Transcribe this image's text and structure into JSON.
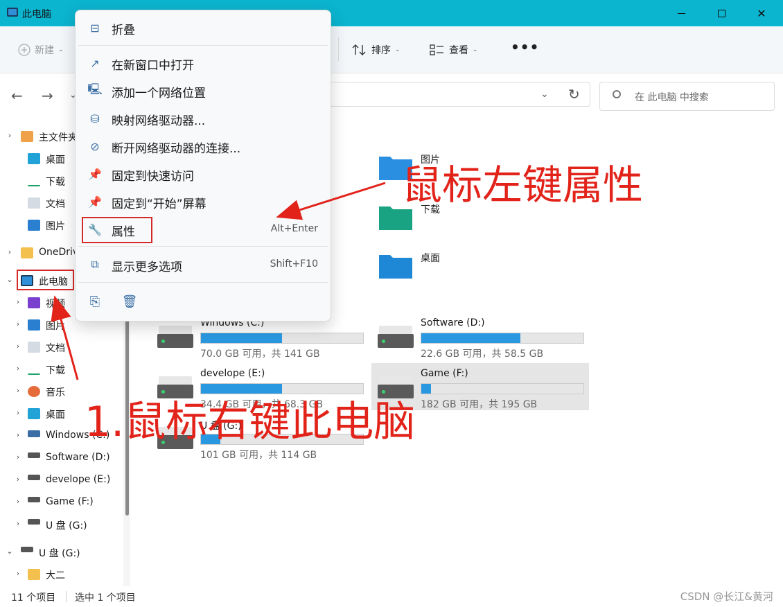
{
  "window": {
    "title": "此电脑",
    "controls": {
      "minimize": "minimize",
      "maximize": "maximize",
      "close": "✕"
    }
  },
  "toolbar": {
    "new_label": "新建",
    "sort_label": "排序",
    "view_label": "查看",
    "more_label": "•••"
  },
  "search": {
    "placeholder": "在 此电脑 中搜索"
  },
  "sidebar": {
    "items": [
      {
        "label": "主文件夹",
        "expander": "›",
        "icon": "home-icon"
      },
      {
        "label": "桌面",
        "icon": "desktop-icon"
      },
      {
        "label": "下载",
        "icon": "download-icon"
      },
      {
        "label": "文档",
        "icon": "document-icon"
      },
      {
        "label": "图片",
        "icon": "pictures-icon"
      },
      {
        "label": "OneDrive",
        "expander": "›",
        "icon": "folder-icon"
      },
      {
        "label": "此电脑",
        "expander": "⌄",
        "icon": "pc-icon"
      },
      {
        "label": "视频",
        "expander": "›",
        "icon": "video-icon"
      },
      {
        "label": "图片",
        "expander": "›",
        "icon": "pictures-icon"
      },
      {
        "label": "文档",
        "expander": "›",
        "icon": "document-icon"
      },
      {
        "label": "下载",
        "expander": "›",
        "icon": "download-icon"
      },
      {
        "label": "音乐",
        "expander": "›",
        "icon": "music-icon"
      },
      {
        "label": "桌面",
        "expander": "›",
        "icon": "desktop-icon"
      },
      {
        "label": "Windows (C:)",
        "expander": "›",
        "icon": "windows-drive-icon"
      },
      {
        "label": "Software (D:)",
        "expander": "›",
        "icon": "drive-icon"
      },
      {
        "label": "develope (E:)",
        "expander": "›",
        "icon": "drive-icon"
      },
      {
        "label": "Game (F:)",
        "expander": "›",
        "icon": "drive-icon"
      },
      {
        "label": "U 盘 (G:)",
        "expander": "›",
        "icon": "drive-icon"
      },
      {
        "label": "U 盘 (G:)",
        "expander": "⌄",
        "icon": "drive-icon"
      },
      {
        "label": "大二",
        "expander": "›",
        "icon": "folder-icon"
      }
    ]
  },
  "folders": [
    {
      "label": "图片",
      "color": "#2a8fe0"
    },
    {
      "label": "下载",
      "color": "#1aa383"
    },
    {
      "label": "桌面",
      "color": "#1e88d6"
    }
  ],
  "drives": [
    {
      "name": "Windows (C:)",
      "info": "70.0 GB 可用，共 141 GB",
      "used": 0.5
    },
    {
      "name": "Software (D:)",
      "info": "22.6 GB 可用，共 58.5 GB",
      "used": 0.61
    },
    {
      "name": "develope (E:)",
      "info": "34.4 GB 可用，共 68.3 GB",
      "used": 0.5
    },
    {
      "name": "Game (F:)",
      "info": "182 GB 可用，共 195 GB",
      "used": 0.06
    },
    {
      "name": "U 盘 (G:)",
      "info": "101 GB 可用，共 114 GB",
      "used": 0.12
    }
  ],
  "context_menu": {
    "items": [
      {
        "label": "折叠",
        "icon": "collapse-icon"
      },
      {
        "label": "在新窗口中打开",
        "icon": "open-new-window-icon"
      },
      {
        "label": "添加一个网络位置",
        "icon": "network-location-icon"
      },
      {
        "label": "映射网络驱动器...",
        "icon": "map-drive-icon"
      },
      {
        "label": "断开网络驱动器的连接...",
        "icon": "disconnect-drive-icon"
      },
      {
        "label": "固定到快速访问",
        "icon": "pin-icon"
      },
      {
        "label": "固定到“开始”屏幕",
        "icon": "pin-icon"
      },
      {
        "label": "属性",
        "icon": "wrench-icon",
        "shortcut": "Alt+Enter"
      },
      {
        "label": "显示更多选项",
        "icon": "more-options-icon",
        "shortcut": "Shift+F10"
      }
    ]
  },
  "annotations": {
    "step1": "1.鼠标右键此电脑",
    "step2": "鼠标左键属性"
  },
  "status": {
    "count": "11 个项目",
    "selected": "选中 1 个项目",
    "watermark": "CSDN @长江&黄河"
  },
  "colors": {
    "titlebar": "#0bb4cf",
    "accent": "#2a98e0",
    "annotation": "#e2231a"
  }
}
